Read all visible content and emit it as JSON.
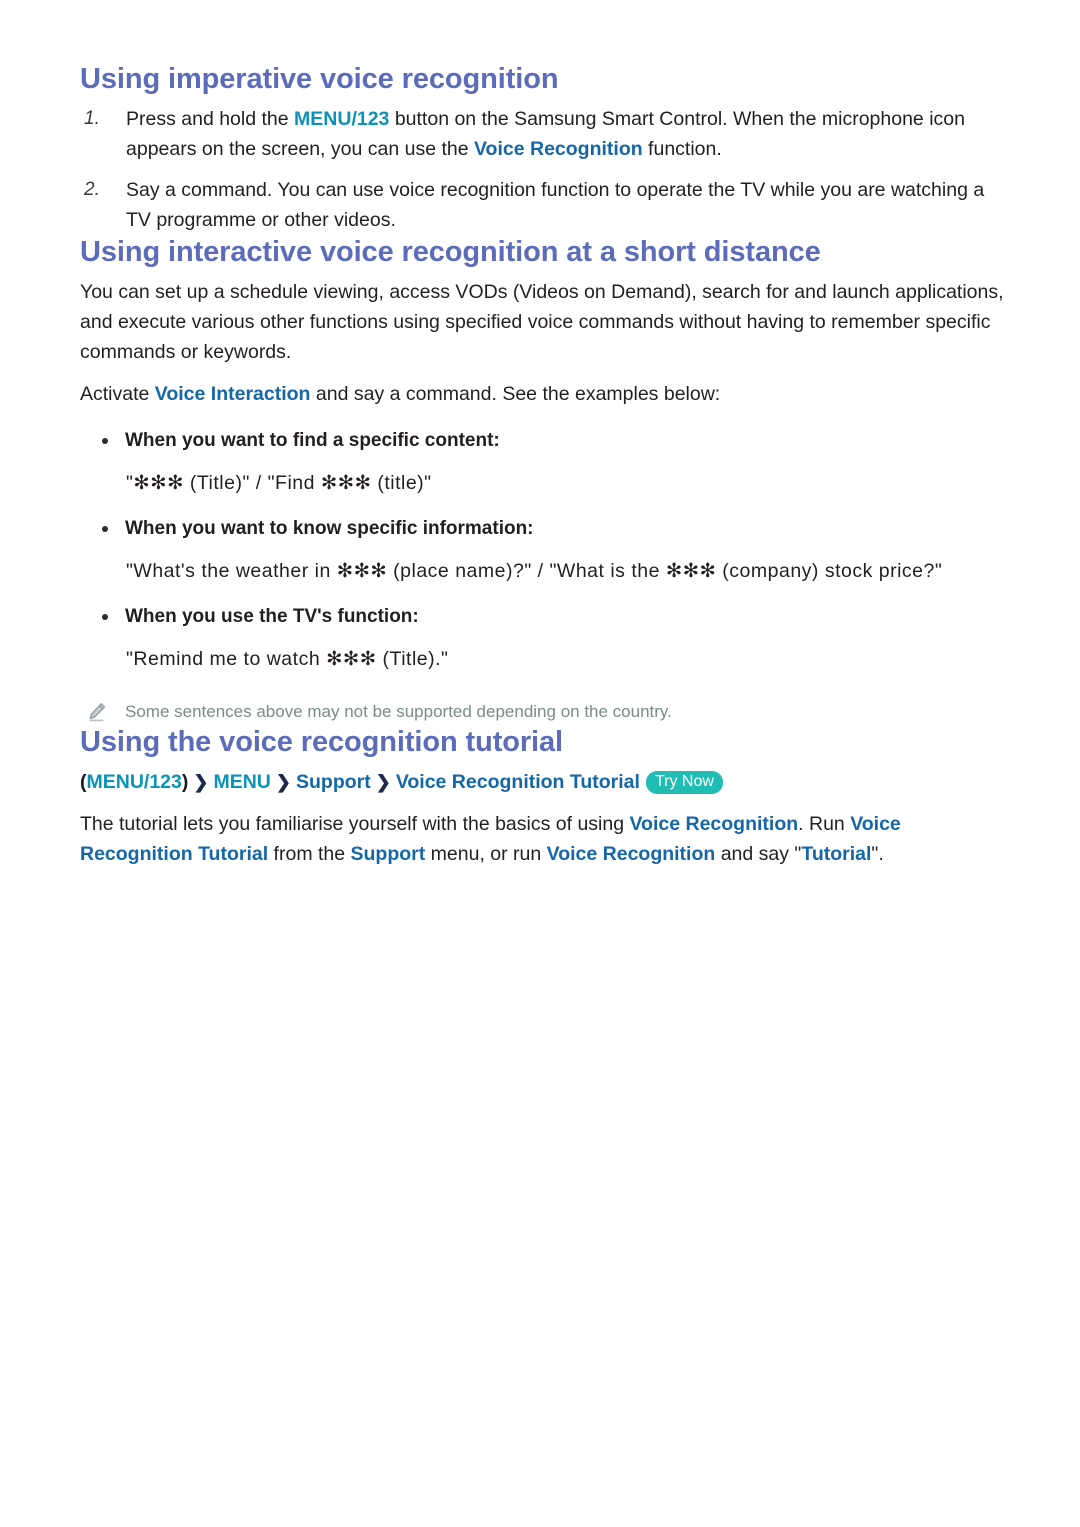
{
  "page": {
    "background": "#ffffff",
    "heading_color": "#5d6cba",
    "link_blue": "#1567a8",
    "link_teal": "#0b93b8",
    "badge_teal": "#21bdb4",
    "note_color": "#7c8a8a",
    "body_color": "#231f20"
  },
  "section1": {
    "heading": "Using imperative voice recognition",
    "steps": [
      {
        "marker": "1.",
        "part1": "Press and hold the ",
        "link1": "MENU/123",
        "part2": " button on the Samsung Smart Control. When the microphone icon appears on the screen, you can use the ",
        "link2": "Voice Recognition",
        "part3": " function."
      },
      {
        "marker": "2.",
        "part1": "Say a command. You can use voice recognition function to operate the TV while you are watching a TV programme or other videos.",
        "link1": "",
        "part2": "",
        "link2": "",
        "part3": ""
      }
    ]
  },
  "section2": {
    "heading": "Using interactive voice recognition at a short distance",
    "paragraph1": "You can set up a schedule viewing, access VODs (Videos on Demand), search for and launch applications, and execute various other functions using specified voice commands without having to remember specific commands or keywords.",
    "paragraph2_prefix": "Activate ",
    "paragraph2_link": "Voice Interaction",
    "paragraph2_suffix": " and say a command. See the examples below:",
    "examples": [
      {
        "label": "When you want to find a specific content:",
        "text": "\"✻✻✻ (Title)\" / \"Find ✻✻✻ (title)\""
      },
      {
        "label": "When you want to know specific information:",
        "text": "\"What's the weather in ✻✻✻ (place name)?\" / \"What is the ✻✻✻ (company) stock price?\""
      },
      {
        "label": "When you use the TV's function:",
        "text": "\"Remind me to watch ✻✻✻ (Title).\""
      }
    ],
    "note": {
      "icon": "pencil-icon",
      "text": "Some sentences above may not be supported depending on the country."
    }
  },
  "section3": {
    "heading": "Using the voice recognition tutorial",
    "breadcrumb": {
      "open_paren": "(",
      "item1": "MENU/123",
      "close_paren": ")",
      "chevron": "❯",
      "item2": "MENU",
      "item3": "Support",
      "item4": "Voice Recognition Tutorial",
      "badge": "Try Now"
    },
    "paragraph": {
      "p1": "The tutorial lets you familiarise yourself with the basics of using ",
      "l1": "Voice Recognition",
      "p2": ". Run ",
      "l2": "Voice Recognition Tutorial",
      "p3": " from the ",
      "l3": "Support",
      "p4": " menu, or run ",
      "l4": "Voice Recognition",
      "p5": " and say \"",
      "l5": "Tutorial",
      "p6": "\"."
    }
  }
}
